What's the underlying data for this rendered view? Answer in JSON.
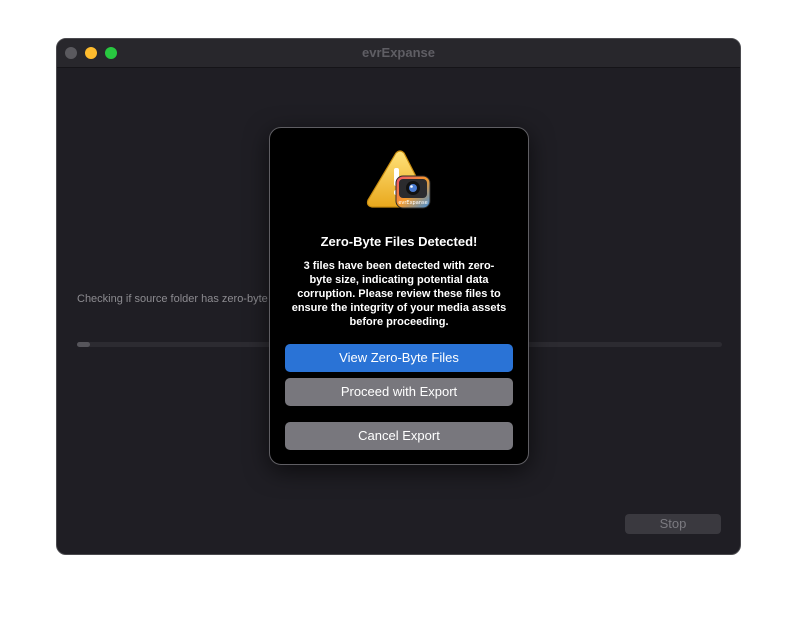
{
  "window": {
    "title": "evrExpanse"
  },
  "main": {
    "status_text": "Checking if source folder has zero-byte files...",
    "progress": 0.02,
    "stop_label": "Stop"
  },
  "dialog": {
    "icon": "warning-app-icon",
    "icon_badge_text": "evrExpanse",
    "title": "Zero-Byte Files Detected!",
    "message_lines": [
      "3 files have been detected with zero-",
      "byte size, indicating potential data",
      "corruption. Please review these files to",
      "ensure the integrity of your media assets",
      "before proceeding."
    ],
    "buttons": {
      "view": "View Zero-Byte Files",
      "proceed": "Proceed with Export",
      "cancel": "Cancel Export"
    }
  },
  "colors": {
    "accent": "#2a73d6",
    "window_bg": "#1f1e24",
    "dialog_bg": "#000000",
    "secondary_button": "#78777d"
  }
}
